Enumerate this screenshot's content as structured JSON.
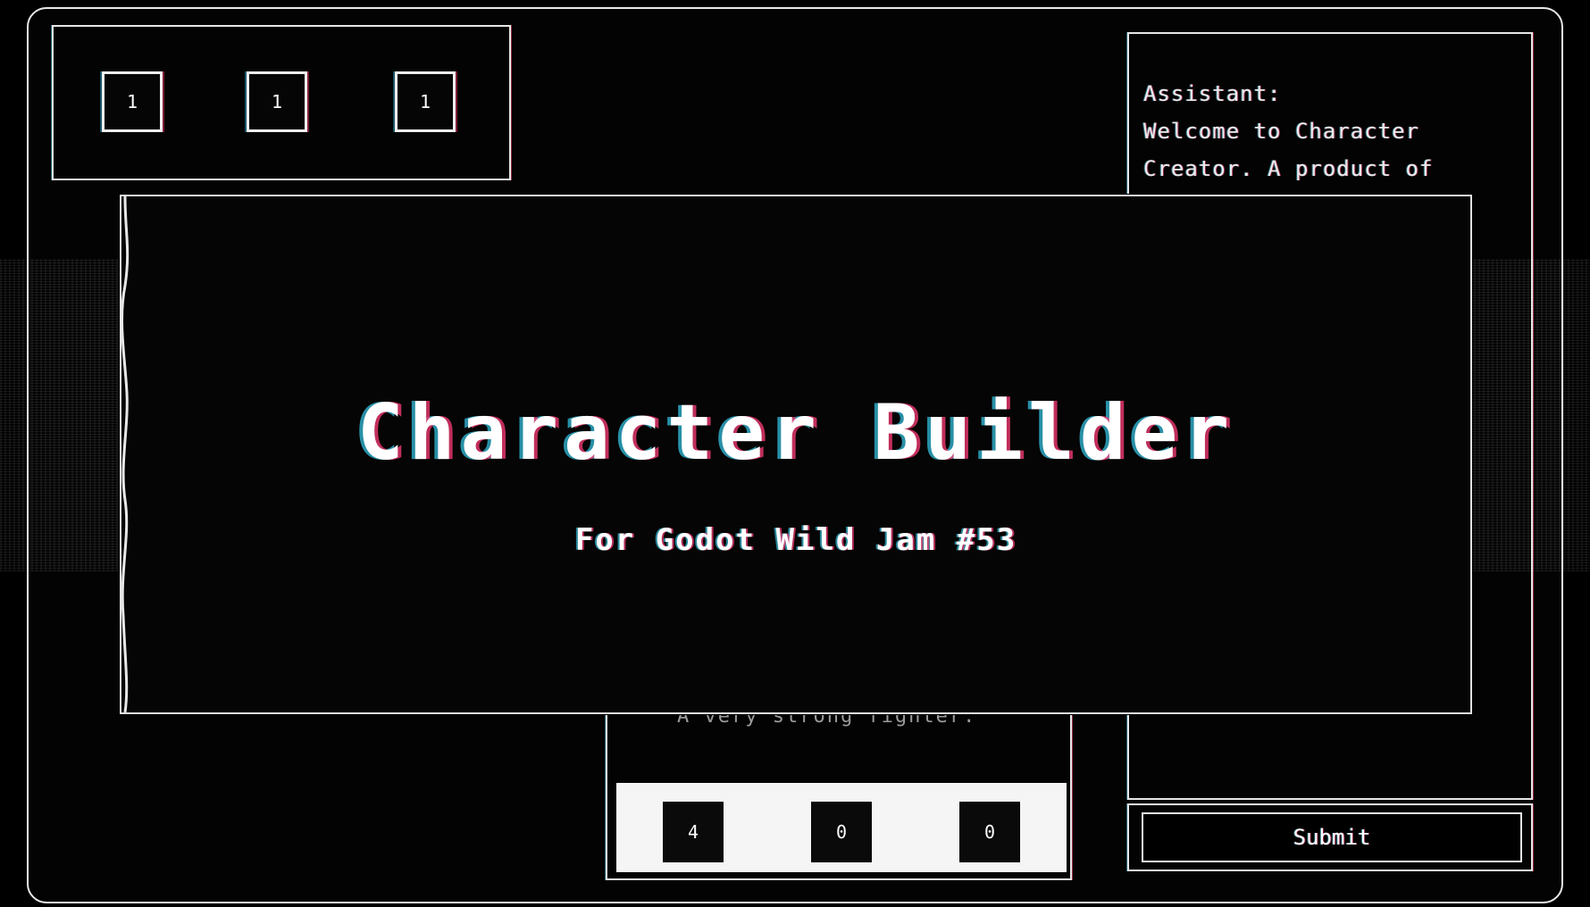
{
  "top_stats": [
    "1",
    "1",
    "1"
  ],
  "assistant": {
    "label": "Assistant:",
    "line1": "Welcome to Character",
    "line2": "Creator. A product of"
  },
  "description_partial": "A very strong fighter.",
  "bottom_stats": [
    "4",
    "0",
    "0"
  ],
  "submit_label": "Submit",
  "splash": {
    "title": "Character Builder",
    "subtitle": "For Godot Wild Jam #53"
  }
}
